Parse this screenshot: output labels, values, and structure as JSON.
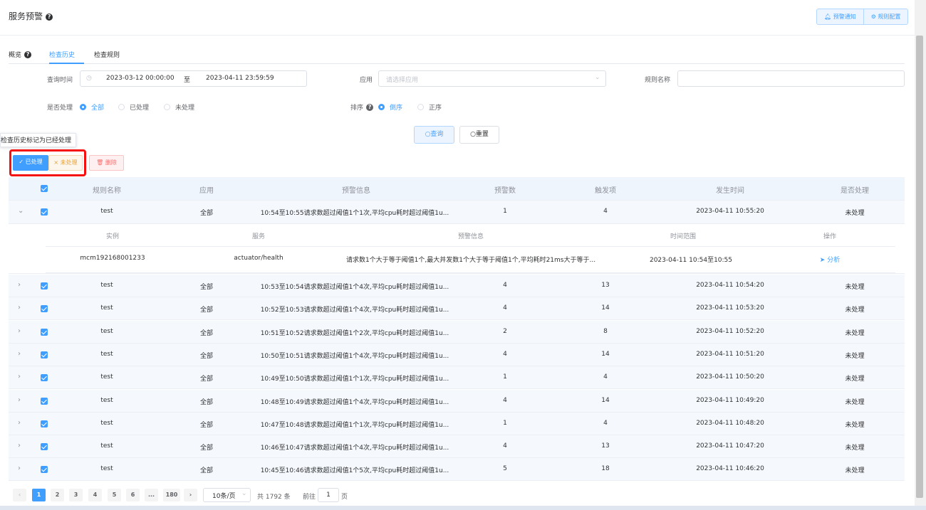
{
  "header": {
    "title": "服务预警",
    "buttons": [
      "预警通知",
      "规则配置"
    ]
  },
  "tabs": [
    "概览",
    "检查历史",
    "检查规则"
  ],
  "filters": {
    "time_label": "查询时间",
    "start": "2023-03-12 00:00:00",
    "sep": "至",
    "end": "2023-04-11 23:59:59",
    "app_label": "应用",
    "app_placeholder": "请选择应用",
    "rule_label": "规则名称",
    "handled_label": "是否处理",
    "handled_options": [
      "全部",
      "已处理",
      "未处理"
    ],
    "sort_label": "排序",
    "sort_options": [
      "倒序",
      "正序"
    ]
  },
  "buttons": {
    "query": "查询",
    "reset": "重置"
  },
  "tooltip": "检查历史标记为已经处理",
  "actions": {
    "handled": "已处理",
    "unhandled": "未处理",
    "delete": "删除"
  },
  "table": {
    "columns": [
      "规则名称",
      "应用",
      "预警信息",
      "预警数",
      "触发项",
      "发生时间",
      "是否处理"
    ],
    "first_row": {
      "rule": "test",
      "app": "全部",
      "info": "10:54至10:55请求数超过阈值1个1次,平均cpu耗时超过阈值1u...",
      "count": "1",
      "trigger": "4",
      "time": "2023-04-11 10:55:20",
      "handled": "未处理"
    },
    "sub_columns": [
      "实例",
      "服务",
      "预警信息",
      "时间范围",
      "操作"
    ],
    "sub_row": {
      "instance": "mcm192168001233",
      "service": "actuator/health",
      "info": "请求数1个大于等于阈值1个,最大并发数1个大于等于阈值1个,平均耗时21ms大于等于...",
      "range": "2023-04-11 10:54至10:55",
      "op": "分析"
    },
    "rows": [
      {
        "rule": "test",
        "app": "全部",
        "info": "10:53至10:54请求数超过阈值1个4次,平均cpu耗时超过阈值1u...",
        "count": "4",
        "trigger": "13",
        "time": "2023-04-11 10:54:20",
        "handled": "未处理"
      },
      {
        "rule": "test",
        "app": "全部",
        "info": "10:52至10:53请求数超过阈值1个4次,平均cpu耗时超过阈值1u...",
        "count": "4",
        "trigger": "14",
        "time": "2023-04-11 10:53:20",
        "handled": "未处理"
      },
      {
        "rule": "test",
        "app": "全部",
        "info": "10:51至10:52请求数超过阈值1个2次,平均cpu耗时超过阈值1u...",
        "count": "2",
        "trigger": "8",
        "time": "2023-04-11 10:52:20",
        "handled": "未处理"
      },
      {
        "rule": "test",
        "app": "全部",
        "info": "10:50至10:51请求数超过阈值1个4次,平均cpu耗时超过阈值1u...",
        "count": "4",
        "trigger": "14",
        "time": "2023-04-11 10:51:20",
        "handled": "未处理"
      },
      {
        "rule": "test",
        "app": "全部",
        "info": "10:49至10:50请求数超过阈值1个1次,平均cpu耗时超过阈值1u...",
        "count": "1",
        "trigger": "4",
        "time": "2023-04-11 10:50:20",
        "handled": "未处理"
      },
      {
        "rule": "test",
        "app": "全部",
        "info": "10:48至10:49请求数超过阈值1个4次,平均cpu耗时超过阈值1u...",
        "count": "4",
        "trigger": "14",
        "time": "2023-04-11 10:49:20",
        "handled": "未处理"
      },
      {
        "rule": "test",
        "app": "全部",
        "info": "10:47至10:48请求数超过阈值1个1次,平均cpu耗时超过阈值1u...",
        "count": "1",
        "trigger": "4",
        "time": "2023-04-11 10:48:20",
        "handled": "未处理"
      },
      {
        "rule": "test",
        "app": "全部",
        "info": "10:46至10:47请求数超过阈值1个4次,平均cpu耗时超过阈值1u...",
        "count": "4",
        "trigger": "13",
        "time": "2023-04-11 10:47:20",
        "handled": "未处理"
      },
      {
        "rule": "test",
        "app": "全部",
        "info": "10:45至10:46请求数超过阈值1个5次,平均cpu耗时超过阈值1u...",
        "count": "5",
        "trigger": "18",
        "time": "2023-04-11 10:46:20",
        "handled": "未处理"
      }
    ]
  },
  "pagination": {
    "pages": [
      "1",
      "2",
      "3",
      "4",
      "5",
      "6",
      "...",
      "180"
    ],
    "page_size": "10条/页",
    "total": "共 1792 条",
    "goto_label": "前往",
    "goto_value": "1",
    "goto_suffix": "页"
  }
}
